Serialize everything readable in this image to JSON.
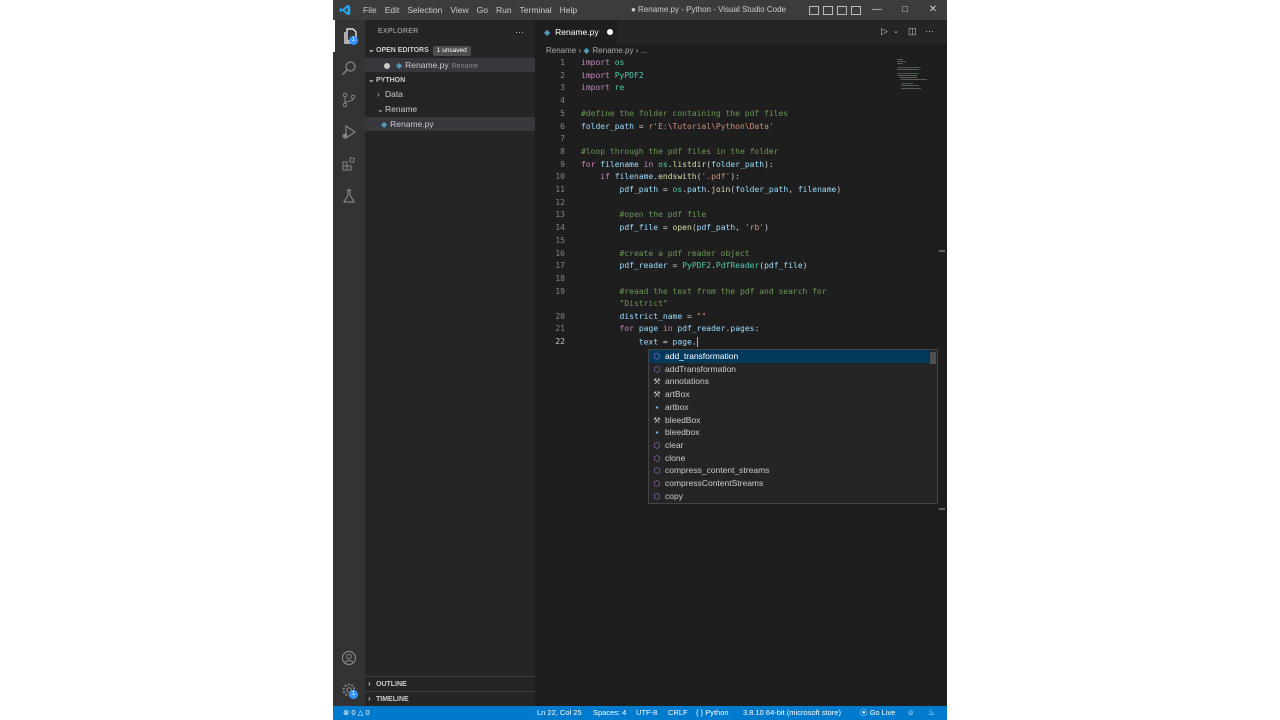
{
  "titlebar": {
    "menu": [
      "File",
      "Edit",
      "Selection",
      "View",
      "Go",
      "Run",
      "Terminal",
      "Help"
    ],
    "window_title": "● Rename.py - Python - Visual Studio Code"
  },
  "activitybar": {
    "accounts_badge": "1",
    "explorer_badge": "1"
  },
  "sidebar": {
    "title": "EXPLORER",
    "open_editors": {
      "label": "OPEN EDITORS",
      "badge": "1 unsaved",
      "items": [
        {
          "name": "Rename.py",
          "desc": "Rename"
        }
      ]
    },
    "workspace": {
      "label": "PYTHON",
      "tree": [
        {
          "name": "Data"
        },
        {
          "name": "Rename"
        },
        {
          "name": "Rename.py"
        }
      ]
    },
    "outline_label": "OUTLINE",
    "timeline_label": "TIMELINE"
  },
  "tab": {
    "label": "Rename.py"
  },
  "breadcrumb": {
    "folder": "Rename",
    "file": "Rename.py",
    "more": "..."
  },
  "editor": {
    "cursor_line": "22",
    "lines": [
      {
        "n": "1"
      },
      {
        "n": "2"
      },
      {
        "n": "3"
      },
      {
        "n": "4"
      },
      {
        "n": "5"
      },
      {
        "n": "6"
      },
      {
        "n": "7"
      },
      {
        "n": "8"
      },
      {
        "n": "9"
      },
      {
        "n": "10"
      },
      {
        "n": "11"
      },
      {
        "n": "12"
      },
      {
        "n": "13"
      },
      {
        "n": "14"
      },
      {
        "n": "15"
      },
      {
        "n": "16"
      },
      {
        "n": "17"
      },
      {
        "n": "18"
      },
      {
        "n": "19"
      },
      {
        "n": "20"
      },
      {
        "n": "21"
      },
      {
        "n": "22"
      }
    ],
    "code": {
      "l1": [
        "import",
        "os"
      ],
      "l2": [
        "import",
        "PyPDF2"
      ],
      "l3": [
        "import",
        "re"
      ],
      "l5": "#define the folder containing the pdf files",
      "l6": [
        "folder_path",
        "=",
        "r'E:\\Tutorial\\Python\\Data'"
      ],
      "l8": "#loop through the pdf files in the folder",
      "l9": [
        "for",
        "filename",
        "in",
        "os",
        ".",
        "listdir",
        "(",
        "folder_path",
        "):"
      ],
      "l10": [
        "if",
        "filename",
        ".",
        "endswith",
        "(",
        "'.pdf'",
        "):"
      ],
      "l11": [
        "pdf_path",
        "=",
        "os",
        ".",
        "path",
        ".",
        "join",
        "(",
        "folder_path",
        ", ",
        "filename",
        ")"
      ],
      "l13": "#open the pdf file",
      "l14": [
        "pdf_file",
        "=",
        "open",
        "(",
        "pdf_path",
        ", ",
        "'rb'",
        ")"
      ],
      "l16": "#create a pdf reader object",
      "l17": [
        "pdf_reader",
        "=",
        "PyPDF2",
        ".",
        "PdfReader",
        "(",
        "pdf_file",
        ")"
      ],
      "l19a": "#reaad the text from the pdf and search for",
      "l19b": "\"District\"",
      "l20": [
        "district_name",
        "=",
        "\"\""
      ],
      "l21": [
        "for",
        "page",
        "in",
        "pdf_reader",
        ".",
        "pages",
        ":"
      ],
      "l22": [
        "text",
        "=",
        "page",
        "."
      ]
    }
  },
  "suggest": {
    "items": [
      {
        "label": "add_transformation",
        "icon": "method-icon",
        "selected": true
      },
      {
        "label": "addTransformation",
        "icon": "method-icon"
      },
      {
        "label": "annotations",
        "icon": "wrench-icon"
      },
      {
        "label": "artBox",
        "icon": "wrench-icon"
      },
      {
        "label": "artbox",
        "icon": "field-icon"
      },
      {
        "label": "bleedBox",
        "icon": "wrench-icon"
      },
      {
        "label": "bleedbox",
        "icon": "field-icon"
      },
      {
        "label": "clear",
        "icon": "method-icon"
      },
      {
        "label": "clone",
        "icon": "method-icon"
      },
      {
        "label": "compress_content_streams",
        "icon": "method-icon"
      },
      {
        "label": "compressContentStreams",
        "icon": "method-icon"
      },
      {
        "label": "copy",
        "icon": "method-icon"
      }
    ]
  },
  "statusbar": {
    "errors": "0",
    "warnings": "0",
    "position": "Ln 22, Col 25",
    "spaces": "Spaces: 4",
    "encoding": "UTF-8",
    "eol": "CRLF",
    "language": "Python",
    "interpreter": "3.8.10 64-bit (microsoft store)",
    "golive": "Go Live"
  },
  "colors": {
    "statusbar": "#007acc",
    "editor_bg": "#1e1e1e",
    "sidebar_bg": "#252526",
    "activity_bg": "#333333"
  }
}
